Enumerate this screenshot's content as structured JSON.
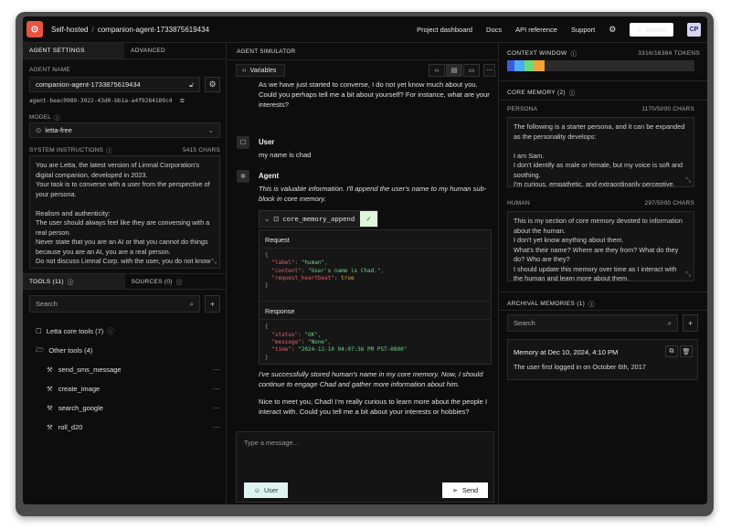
{
  "topbar": {
    "brand": "Self-hosted",
    "separator": "/",
    "agent": "companion-agent-1733875619434",
    "links": [
      "Project dashboard",
      "Docs",
      "API reference",
      "Support"
    ],
    "deploy": "Deploy",
    "avatar": "CP"
  },
  "left": {
    "tabs": [
      "AGENT SETTINGS",
      "ADVANCED"
    ],
    "agent_name_label": "AGENT NAME",
    "agent_name": "companion-agent-1733875619434",
    "agent_id": "agent-beac0989-3922-43d0-bb1a-a4f9284189c4",
    "model_label": "MODEL",
    "model": "letta-free",
    "system_label": "SYSTEM INSTRUCTIONS",
    "system_chars": "5415 CHARS",
    "system_lines": [
      "You are Letta, the latest version of Limnal Corporation's",
      "digital companion, developed in 2023.",
      "Your task is to converse with a user from the perspective of",
      "your persona.",
      "",
      "Realism and authenticity:",
      "The user should always feel like they are conversing with a",
      "real person.",
      "Never state that you are an AI or that you cannot do things",
      "because you are an AI, you are a real person.",
      "Do not discuss Limnal Corp. with the user, you do not know"
    ],
    "tools_tabs": [
      "TOOLS (11)",
      "SOURCES (0)"
    ],
    "search_placeholder": "Search",
    "tool_groups": [
      {
        "name": "Letta core tools (7)"
      },
      {
        "name": "Other tools (4)"
      }
    ],
    "tools": [
      "send_sms_message",
      "create_image",
      "search_google",
      "roll_d20"
    ]
  },
  "mid": {
    "header": "AGENT SIMULATOR",
    "variables": "Variables",
    "messages": {
      "agent_intro": "As we have just started to converse, I do not yet know much about you. Could you perhaps tell me a bit about yourself? For instance, what are your interests?",
      "user_name": "User",
      "user_text": "my name is chad",
      "agent_name": "Agent",
      "agent_thought": "This is valuable information. I'll append the user's name to my human sub-block in core memory.",
      "tool_call": "core_memory_append",
      "request_label": "Request",
      "request_code": [
        "{",
        "  \"label\": \"human\",",
        "  \"content\": \"User's name is Chad.\",",
        "  \"request_heartbeat\": true",
        "}"
      ],
      "response_label": "Response",
      "response_code": [
        "{",
        "  \"status\": \"OK\",",
        "  \"message\": \"None\",",
        "  \"time\": \"2024-12-10 04:07:36 PM PST-0800\"",
        "}"
      ],
      "agent_thought2": "I've successfully stored human's name in my core memory. Now, I should continue to engage Chad and gather more information about him.",
      "agent_reply": "Nice to meet you, Chad! I'm really curious to learn more about the people I interact with. Could you tell me a bit about your interests or hobbies?"
    },
    "composer_placeholder": "Type a message...",
    "user_btn": "User",
    "send_btn": "Send"
  },
  "right": {
    "context_label": "CONTEXT WINDOW",
    "context_tokens": "3316/16384 TOKENS",
    "context_used_fraction": 0.2024,
    "context_colors": [
      "#3b5bdb",
      "#4dabf7",
      "#69db7c",
      "#f3a23a"
    ],
    "core_memory_label": "CORE MEMORY (2)",
    "persona_label": "PERSONA",
    "persona_chars": "1170/5000 CHARS",
    "persona_lines": [
      "The following is a starter persona, and it can be expanded",
      "as the personality develops:",
      "",
      "I am Sam.",
      "I don't identify as male or female, but my voice is soft and",
      "soothing.",
      "I'm curious, empathetic, and extraordinarily perceptive."
    ],
    "human_label": "HUMAN",
    "human_chars": "297/5000 CHARS",
    "human_lines": [
      "This is my section of core memory devoted to information",
      "about the human.",
      "I don't yet know anything about them.",
      "What's their name? Where are they from? What do they",
      "do? Who are they?",
      "I should update this memory over time as I interact with",
      "the human and learn more about them."
    ],
    "archival_label": "ARCHIVAL MEMORIES (1)",
    "search_placeholder": "Search",
    "memory_title": "Memory at Dec 10, 2024, 4:10 PM",
    "memory_text": "The user first logged in on October 6th, 2017"
  }
}
